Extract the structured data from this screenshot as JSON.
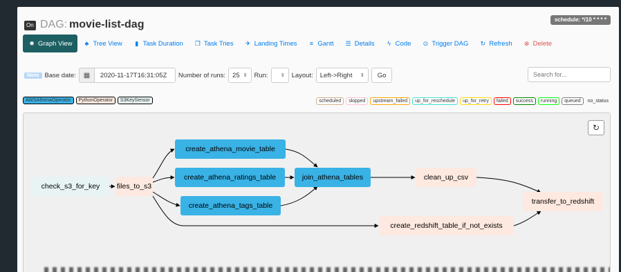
{
  "header": {
    "toggle": "On",
    "dag_prefix": "DAG:",
    "dag_name": "movie-list-dag",
    "schedule": "schedule: */10 * * * *"
  },
  "nav": [
    {
      "label": "Graph View",
      "icon": "gear-icon",
      "glyph": "✹",
      "active": true
    },
    {
      "label": "Tree View",
      "icon": "tree-icon",
      "glyph": "♣"
    },
    {
      "label": "Task Duration",
      "icon": "bar-chart-icon",
      "glyph": "▮"
    },
    {
      "label": "Task Tries",
      "icon": "duplicate-icon",
      "glyph": "❐"
    },
    {
      "label": "Landing Times",
      "icon": "plane-icon",
      "glyph": "✈"
    },
    {
      "label": "Gantt",
      "icon": "align-left-icon",
      "glyph": "≡"
    },
    {
      "label": "Details",
      "icon": "list-icon",
      "glyph": "☰"
    },
    {
      "label": "Code",
      "icon": "flash-icon",
      "glyph": "ϟ"
    },
    {
      "label": "Trigger DAG",
      "icon": "play-circle-icon",
      "glyph": "⊙"
    },
    {
      "label": "Refresh",
      "icon": "refresh-icon",
      "glyph": "↻"
    },
    {
      "label": "Delete",
      "icon": "remove-circle-icon",
      "glyph": "⊗",
      "danger": true
    }
  ],
  "filter": {
    "badge": "None",
    "base_date_label": "Base date:",
    "base_date": "2020-11-17T16:31:05Z",
    "num_runs_label": "Number of runs:",
    "num_runs": "25",
    "run_label": "Run:",
    "run": "",
    "layout_label": "Layout:",
    "layout": "Left->Right",
    "go": "Go",
    "search_placeholder": "Search for..."
  },
  "operators": [
    {
      "label": "AWSAthenaOperator",
      "color": "#39b2e6"
    },
    {
      "label": "PythonOperator",
      "color": "#fde9df"
    },
    {
      "label": "S3KeySensor",
      "color": "#e8f4f4"
    }
  ],
  "statuses": [
    {
      "label": "scheduled",
      "color": "#d2b48c"
    },
    {
      "label": "skipped",
      "color": "#ffc0cb"
    },
    {
      "label": "upstream_failed",
      "color": "#ffa500"
    },
    {
      "label": "up_for_reschedule",
      "color": "#40e0d0"
    },
    {
      "label": "up_for_retry",
      "color": "#ffd700"
    },
    {
      "label": "failed",
      "color": "#ff0000"
    },
    {
      "label": "success",
      "color": "#008000"
    },
    {
      "label": "running",
      "color": "#00ff00"
    },
    {
      "label": "queued",
      "color": "#808080"
    },
    {
      "label": "no_status",
      "color": "none"
    }
  ],
  "graph": {
    "nodes": {
      "check_s3_for_key": "check_s3_for_key",
      "files_to_s3": "files_to_s3",
      "create_athena_movie_table": "create_athena_movie_table",
      "create_athena_ratings_table": "create_athena_ratings_table",
      "create_athena_tags_table": "create_athena_tags_table",
      "join_athena_tables": "join_athena_tables",
      "clean_up_csv": "clean_up_csv",
      "create_redshift_table_if_not_exists": "create_redshift_table_if_not_exists",
      "transfer_to_redshift": "transfer_to_redshift"
    }
  }
}
